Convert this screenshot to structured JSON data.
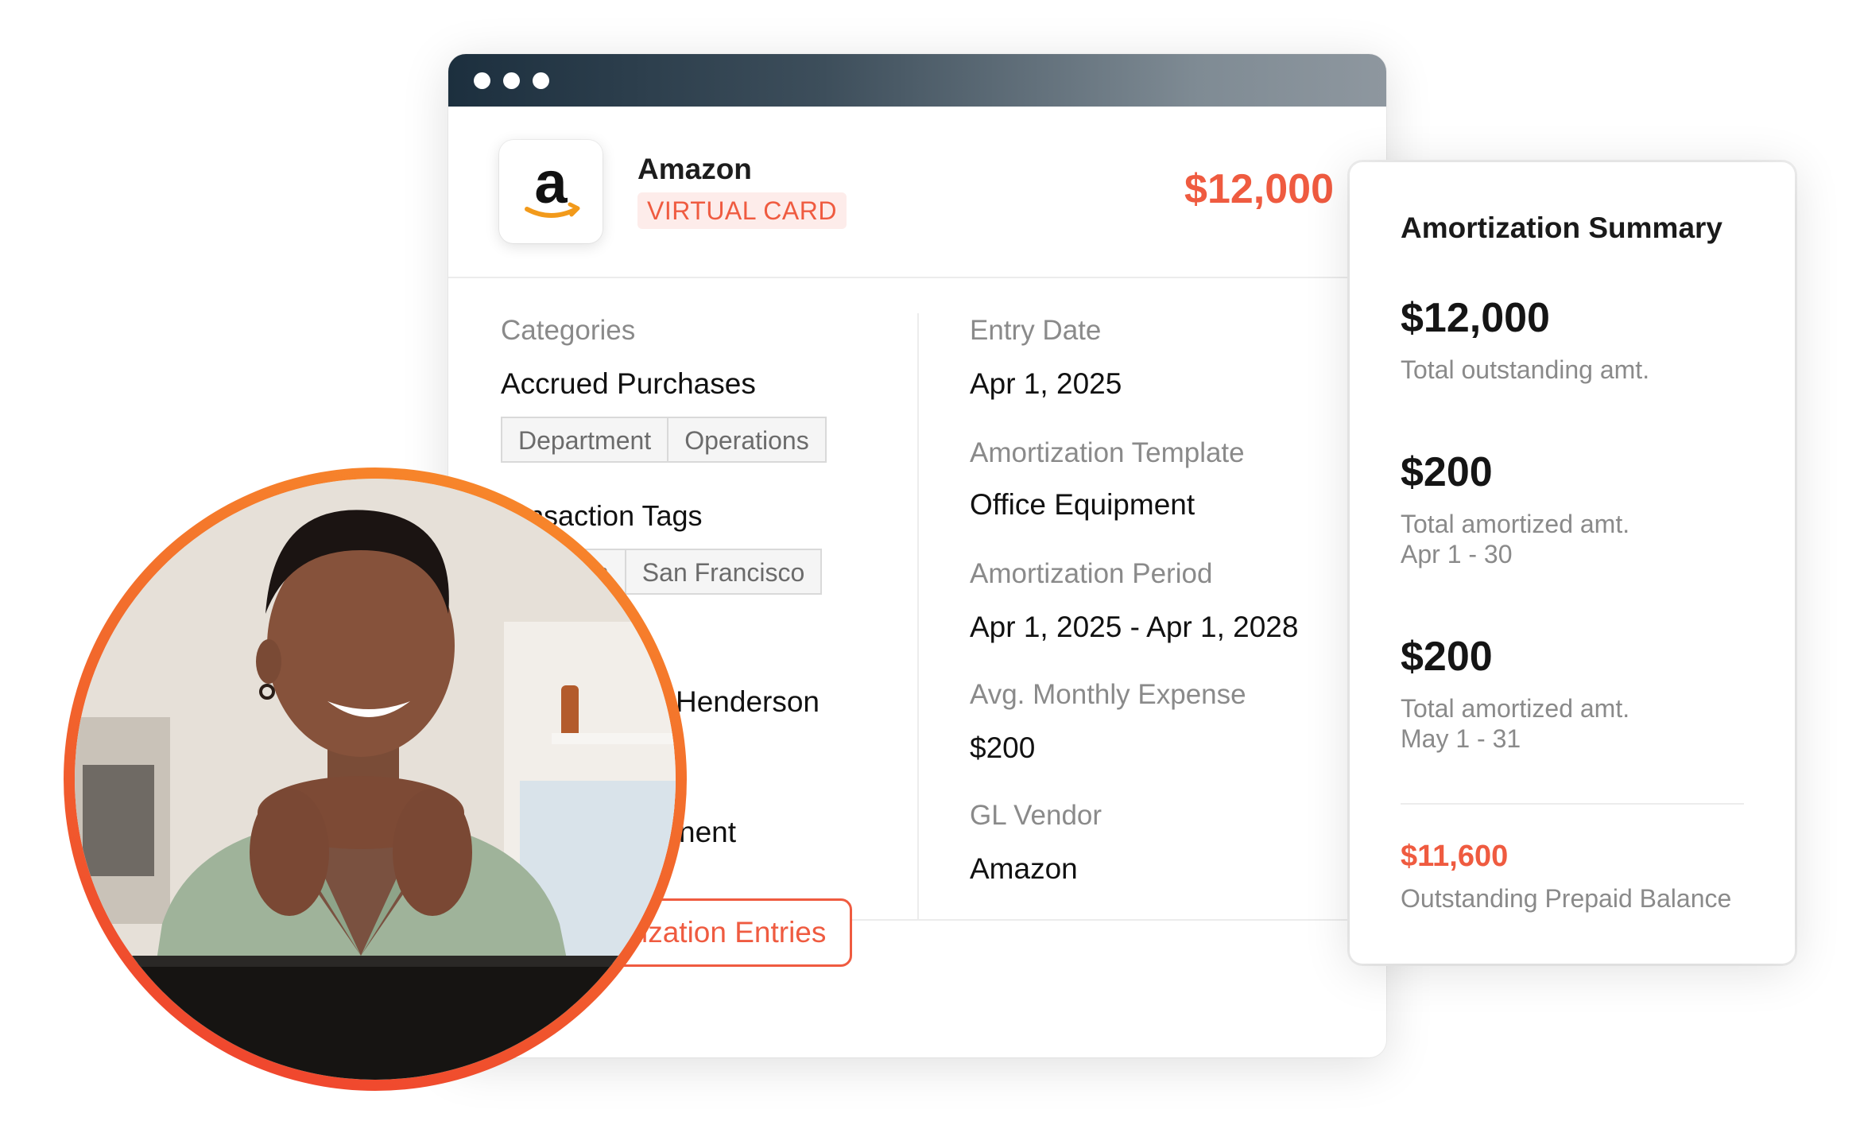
{
  "window": {
    "merchant": {
      "name": "Amazon",
      "badge": "VIRTUAL CARD",
      "amount": "$12,000",
      "logo_letter": "a"
    },
    "left": {
      "categories_label": "Categories",
      "categories_value": "Accrued Purchases",
      "category_chips": [
        "Department",
        "Operations"
      ],
      "tags_label": "nsaction Tags",
      "tag_chips": [
        "n",
        "San Francisco"
      ],
      "partial_name": "Henderson",
      "partial_value": "nent"
    },
    "right": {
      "entry_date_label": "Entry Date",
      "entry_date_value": "Apr 1, 2025",
      "template_label": "Amortization Template",
      "template_value": "Office Equipment",
      "period_label": "Amortization Period",
      "period_value": "Apr 1, 2025 - Apr 1, 2028",
      "avg_label": "Avg. Monthly Expense",
      "avg_value": "$200",
      "vendor_label": "GL Vendor",
      "vendor_value": "Amazon"
    },
    "entries_button": "mortization Entries"
  },
  "summary": {
    "title": "Amortization Summary",
    "total": {
      "amount": "$12,000",
      "label": "Total outstanding amt."
    },
    "periods": [
      {
        "amount": "$200",
        "label": "Total amortized amt.",
        "range": "Apr 1 - 30"
      },
      {
        "amount": "$200",
        "label": "Total amortized amt.",
        "range": "May 1 - 31"
      }
    ],
    "balance": {
      "amount": "$11,600",
      "label": "Outstanding Prepaid Balance"
    }
  },
  "colors": {
    "accent": "#ef5b40",
    "titlebar_dark": "#1c2f3e",
    "ring": "#f26a2c"
  },
  "icons": {
    "logo": "amazon-logo",
    "window_controls": "window-dot"
  }
}
